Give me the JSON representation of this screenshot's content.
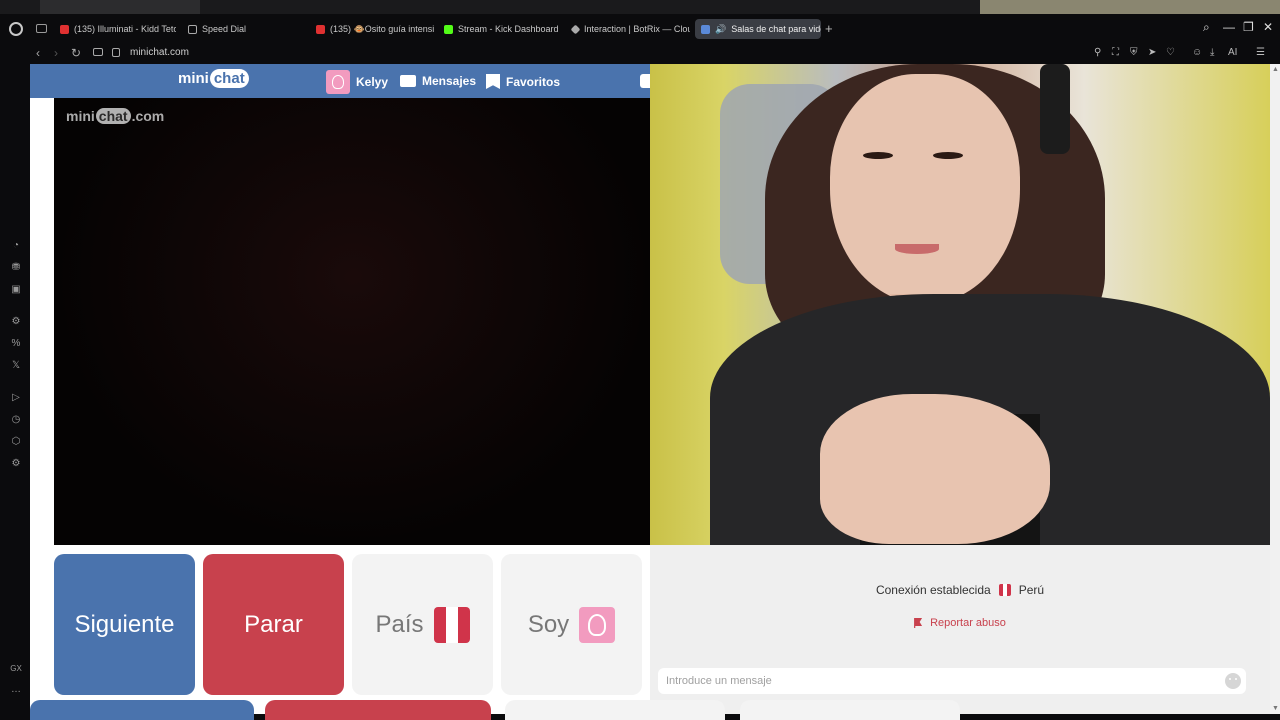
{
  "browser": {
    "tabs": [
      {
        "label": "(135) Illuminati - Kidd Teto",
        "icon": "youtube-icon",
        "active": false
      },
      {
        "label": "Speed Dial",
        "icon": "grid-icon",
        "active": false
      },
      {
        "label": "(135) 🐵Osito guía intensi",
        "icon": "youtube-icon",
        "active": false
      },
      {
        "label": "Stream - Kick Dashboard",
        "icon": "kick-icon",
        "active": false
      },
      {
        "label": "Interaction | BotRix — Clou",
        "icon": "botrix-icon",
        "active": false
      },
      {
        "label": "Salas de chat para vide",
        "icon": "chat-icon",
        "active": true
      }
    ],
    "new_tab_label": "+",
    "url": "minichat.com",
    "ai_label": "AI",
    "sidebar_bottom_label": "GX",
    "sidebar_more_label": "…"
  },
  "site": {
    "logo": {
      "pre": "mini",
      "bubble": "chat"
    },
    "watermark": {
      "pre": "mini",
      "bubble": "chat",
      "post": ".com"
    },
    "nav": {
      "profile_name": "Kelyy",
      "messages_label": "Mensajes",
      "favorites_label": "Favoritos"
    },
    "buttons": {
      "next_label": "Siguiente",
      "stop_label": "Parar",
      "country_label": "País",
      "gender_label": "Soy"
    },
    "chat": {
      "connection_text": "Conexión establecida",
      "country": "Perú",
      "report_label": "Reportar abuso",
      "input_placeholder": "Introduce un mensaje"
    },
    "colors": {
      "brand_blue": "#4a73ad",
      "stop_red": "#c8414d",
      "pink_avatar": "#f29bbf"
    }
  }
}
